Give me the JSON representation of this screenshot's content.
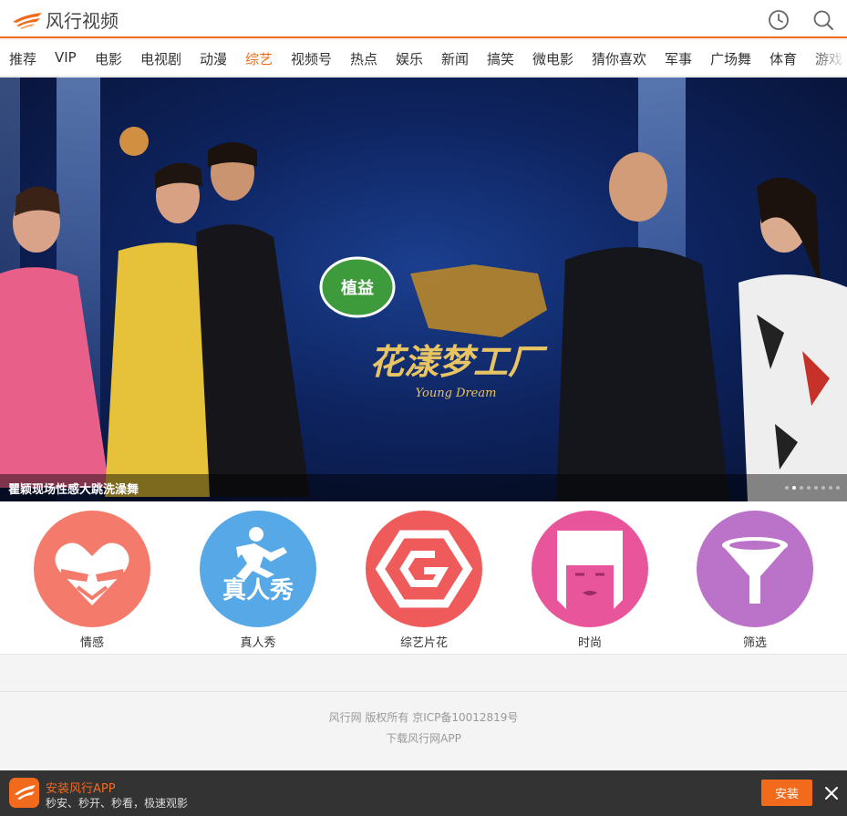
{
  "header": {
    "logo_text": "风行视频",
    "history_icon": "clock-icon",
    "search_icon": "search-icon"
  },
  "nav": {
    "items": [
      "推荐",
      "VIP",
      "电影",
      "电视剧",
      "动漫",
      "综艺",
      "视频号",
      "热点",
      "娱乐",
      "新闻",
      "搞笑",
      "微电影",
      "猜你喜欢",
      "军事",
      "广场舞",
      "体育",
      "游戏"
    ],
    "active": "综艺"
  },
  "banner": {
    "caption": "瞿颖现场性感大跳洗澡舞",
    "slide_count": 8,
    "current_slide": 2,
    "sponsor_text": "植益",
    "show_title": "花漾梦工厂",
    "show_sub": "Young Dream"
  },
  "categories": [
    {
      "label": "情感",
      "icon": "heart-hands-icon",
      "color": "#f47a6b"
    },
    {
      "label": "真人秀",
      "icon": "running-man-icon",
      "color": "#56a8e6",
      "icon_text": "真人秀"
    },
    {
      "label": "综艺片花",
      "icon": "hexagon-g-icon",
      "color": "#ef5a5a"
    },
    {
      "label": "时尚",
      "icon": "woman-face-icon",
      "color": "#e9559b"
    },
    {
      "label": "筛选",
      "icon": "funnel-icon",
      "color": "#bb73c9"
    }
  ],
  "footer": {
    "copyright": "风行网 版权所有 京ICP备10012819号",
    "download_link": "下载风行网APP"
  },
  "app_bar": {
    "title": "安装风行APP",
    "subtitle": "秒安、秒开、秒看，极速观影",
    "install_label": "安装",
    "close_icon": "close-icon"
  },
  "colors": {
    "brand": "#f26b1d"
  }
}
